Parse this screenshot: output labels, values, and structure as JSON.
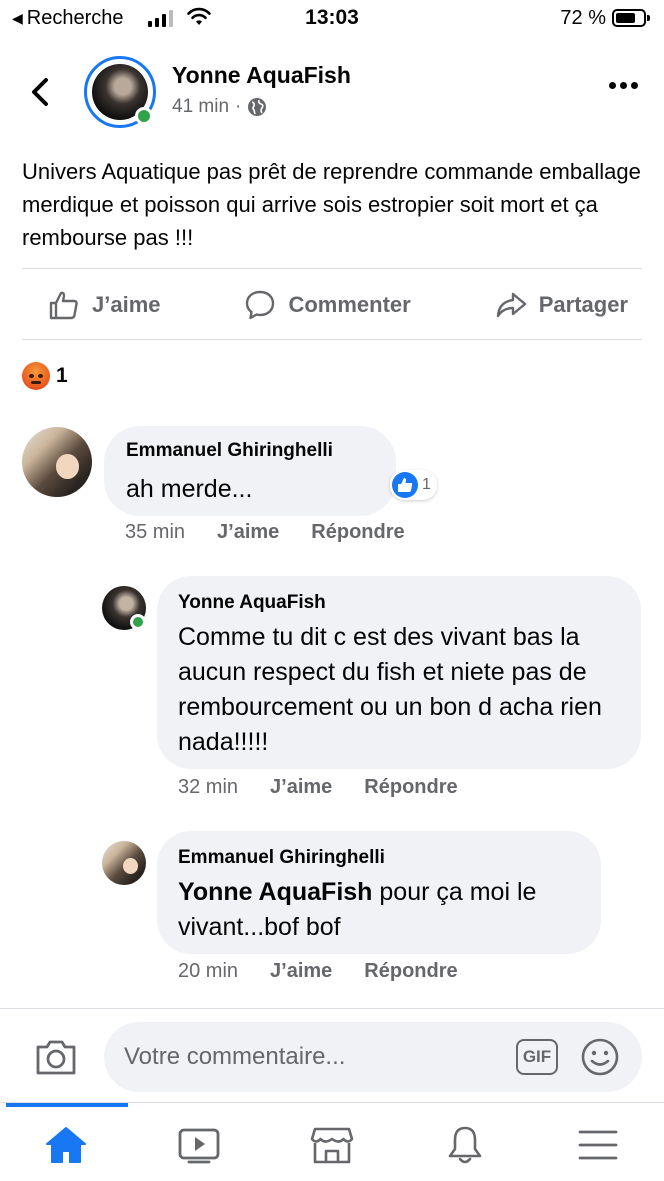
{
  "status_bar": {
    "back_app": "Recherche",
    "time": "13:03",
    "battery_pct": "72 %",
    "battery_level": 0.72
  },
  "post": {
    "author": "Yonne AquaFish",
    "time": "41 min",
    "separator": "·",
    "audience_icon": "globe-icon",
    "text": "Univers Aquatique pas prêt de reprendre commande emballage merdique et poisson qui arrive sois estropier soit mort et ça rembourse pas !!!",
    "actions": {
      "like": "J’aime",
      "comment": "Commenter",
      "share": "Partager"
    },
    "reactions": {
      "icon": "angry-icon",
      "count": "1"
    }
  },
  "comments": [
    {
      "author": "Emmanuel Ghiringhelli",
      "text": "ah merde...",
      "time": "35 min",
      "like_label": "J’aime",
      "reply_label": "Répondre",
      "like_count": "1"
    },
    {
      "author": "Yonne AquaFish",
      "text": "Comme tu dit c est des  vivant bas la aucun respect du fish et niete pas de rembourcement ou un bon d acha rien nada!!!!!",
      "time": "32 min",
      "like_label": "J’aime",
      "reply_label": "Répondre"
    },
    {
      "author": "Emmanuel Ghiringhelli",
      "mention": "Yonne AquaFish",
      "text": " pour ça moi le vivant...bof bof",
      "time": "20 min",
      "like_label": "J’aime",
      "reply_label": "Répondre"
    }
  ],
  "composer": {
    "placeholder": "Votre commentaire...",
    "gif_label": "GIF"
  },
  "tabs": [
    "home-icon",
    "watch-icon",
    "marketplace-icon",
    "notifications-icon",
    "menu-icon"
  ],
  "colors": {
    "accent": "#1877f2",
    "muted": "#65676b",
    "bubble": "#f0f2f5",
    "online": "#31a24c"
  }
}
